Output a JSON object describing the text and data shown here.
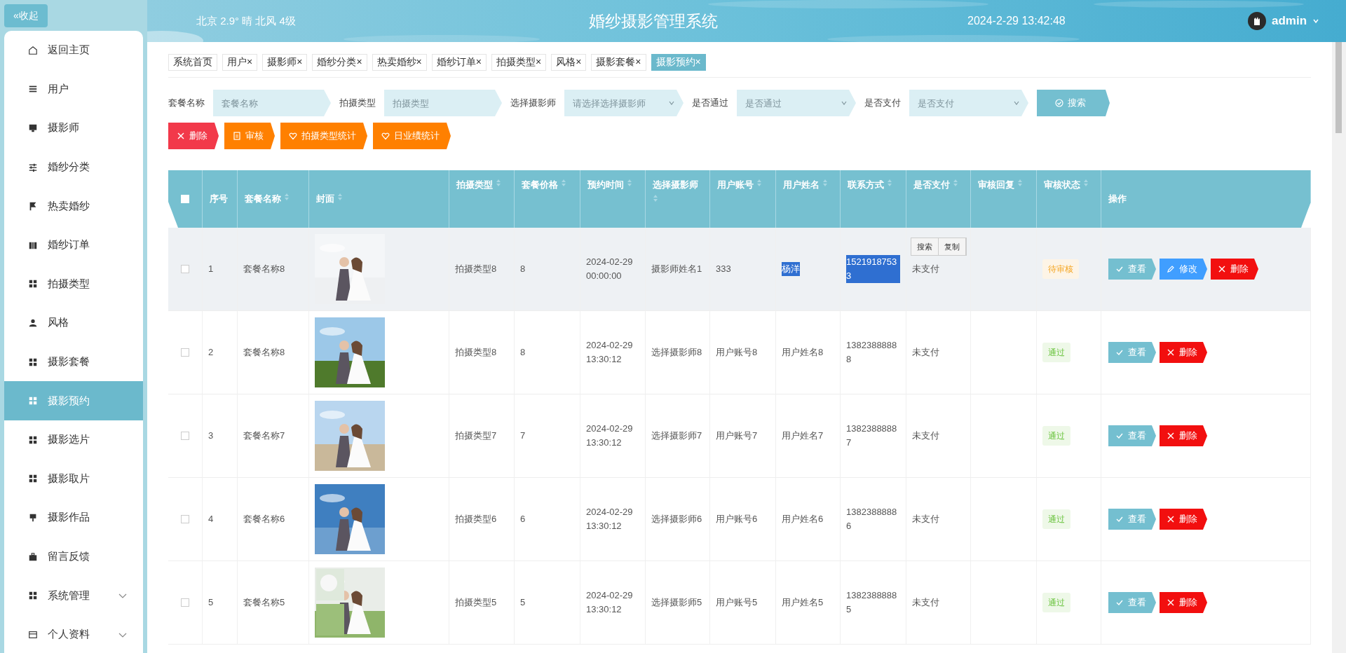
{
  "collapse_button": {
    "icon": "«",
    "label": "收起"
  },
  "header": {
    "weather": "北京 2.9° 晴 北风 4级",
    "title": "婚纱摄影管理系统",
    "datetime": "2024-2-29 13:42:48",
    "user": "admin"
  },
  "sidebar": {
    "items": [
      {
        "label": "返回主页",
        "selected": false,
        "submenu": false
      },
      {
        "label": "用户",
        "selected": false,
        "submenu": false
      },
      {
        "label": "摄影师",
        "selected": false,
        "submenu": false
      },
      {
        "label": "婚纱分类",
        "selected": false,
        "submenu": false
      },
      {
        "label": "热卖婚纱",
        "selected": false,
        "submenu": false
      },
      {
        "label": "婚纱订单",
        "selected": false,
        "submenu": false
      },
      {
        "label": "拍摄类型",
        "selected": false,
        "submenu": false
      },
      {
        "label": "风格",
        "selected": false,
        "submenu": false
      },
      {
        "label": "摄影套餐",
        "selected": false,
        "submenu": false
      },
      {
        "label": "摄影预约",
        "selected": true,
        "submenu": false
      },
      {
        "label": "摄影选片",
        "selected": false,
        "submenu": false
      },
      {
        "label": "摄影取片",
        "selected": false,
        "submenu": false
      },
      {
        "label": "摄影作品",
        "selected": false,
        "submenu": false
      },
      {
        "label": "留言反馈",
        "selected": false,
        "submenu": false
      },
      {
        "label": "系统管理",
        "selected": false,
        "submenu": true
      },
      {
        "label": "个人资料",
        "selected": false,
        "submenu": true
      }
    ]
  },
  "tabs": [
    {
      "label": "系统首页",
      "selected": false
    },
    {
      "label": "用户",
      "close": "×",
      "selected": false
    },
    {
      "label": "摄影师",
      "close": "×",
      "selected": false
    },
    {
      "label": "婚纱分类",
      "close": "×",
      "selected": false
    },
    {
      "label": "热卖婚纱",
      "close": "×",
      "selected": false
    },
    {
      "label": "婚纱订单",
      "close": "×",
      "selected": false
    },
    {
      "label": "拍摄类型",
      "close": "×",
      "selected": false
    },
    {
      "label": "风格",
      "close": "×",
      "selected": false
    },
    {
      "label": "摄影套餐",
      "close": "×",
      "selected": false
    },
    {
      "label": "摄影预约",
      "close": "×",
      "selected": true
    }
  ],
  "filters": [
    {
      "label": "套餐名称",
      "placeholder": "套餐名称",
      "kind": "text"
    },
    {
      "label": "拍摄类型",
      "placeholder": "拍摄类型",
      "kind": "text"
    },
    {
      "label": "选择摄影师",
      "placeholder": "请选择选择摄影师",
      "kind": "select"
    },
    {
      "label": "是否通过",
      "placeholder": "是否通过",
      "kind": "select"
    },
    {
      "label": "是否支付",
      "placeholder": "是否支付",
      "kind": "select"
    }
  ],
  "search_button": "搜索",
  "toolbar": [
    {
      "label": "删除",
      "kind": "delete"
    },
    {
      "label": "审核",
      "kind": "audit"
    },
    {
      "label": "拍摄类型统计",
      "kind": "stats"
    },
    {
      "label": "日业绩统计",
      "kind": "stats"
    }
  ],
  "table": {
    "select_all": {
      "checked": false
    },
    "columns": [
      {
        "label": "序号",
        "sortable": false
      },
      {
        "label": "套餐名称",
        "sortable": true
      },
      {
        "label": "封面",
        "sortable": true
      },
      {
        "label": "拍摄类型",
        "sortable": true
      },
      {
        "label": "套餐价格",
        "sortable": true
      },
      {
        "label": "预约时间",
        "sortable": true
      },
      {
        "label": "选择摄影师",
        "sortable": true
      },
      {
        "label": "用户账号",
        "sortable": true
      },
      {
        "label": "用户姓名",
        "sortable": true
      },
      {
        "label": "联系方式",
        "sortable": true
      },
      {
        "label": "是否支付",
        "sortable": true
      },
      {
        "label": "审核回复",
        "sortable": true
      },
      {
        "label": "审核状态",
        "sortable": true
      },
      {
        "label": "操作",
        "sortable": false
      }
    ],
    "rows": [
      {
        "checked": false,
        "hovered": true,
        "cells": [
          {
            "kind": "text",
            "text": "1",
            "highlighted": false
          },
          {
            "kind": "text",
            "text": "套餐名称8",
            "highlighted": false
          },
          {
            "kind": "picture"
          },
          {
            "kind": "text",
            "text": "拍摄类型8",
            "highlighted": false
          },
          {
            "kind": "text",
            "text": "8",
            "highlighted": false
          },
          {
            "kind": "text",
            "text": "2024-02-29 00:00:00",
            "highlighted": false
          },
          {
            "kind": "text",
            "text": "摄影师姓名1",
            "highlighted": false
          },
          {
            "kind": "text",
            "text": "333",
            "highlighted": false
          },
          {
            "kind": "text",
            "text": "杨洋",
            "highlighted": true
          },
          {
            "kind": "text",
            "text": "15219187533",
            "highlighted": true
          },
          {
            "kind": "text",
            "text": "未支付",
            "highlighted": false,
            "context_menu": [
              "搜索",
              "复制"
            ]
          },
          {
            "kind": "empty"
          },
          {
            "kind": "status",
            "text": "待审核",
            "approved": false
          },
          {
            "kind": "actions",
            "actions": [
              {
                "label": "查看",
                "kind": "view"
              },
              {
                "label": "修改",
                "kind": "edit"
              },
              {
                "label": "删除",
                "kind": "delete"
              }
            ]
          }
        ]
      },
      {
        "checked": false,
        "hovered": false,
        "cells": [
          {
            "kind": "text",
            "text": "2",
            "highlighted": false
          },
          {
            "kind": "text",
            "text": "套餐名称8",
            "highlighted": false
          },
          {
            "kind": "picture"
          },
          {
            "kind": "text",
            "text": "拍摄类型8",
            "highlighted": false
          },
          {
            "kind": "text",
            "text": "8",
            "highlighted": false
          },
          {
            "kind": "text",
            "text": "2024-02-29 13:30:12",
            "highlighted": false
          },
          {
            "kind": "text",
            "text": "选择摄影师8",
            "highlighted": false
          },
          {
            "kind": "text",
            "text": "用户账号8",
            "highlighted": false
          },
          {
            "kind": "text",
            "text": "用户姓名8",
            "highlighted": false
          },
          {
            "kind": "text",
            "text": "13823888888",
            "highlighted": false
          },
          {
            "kind": "text",
            "text": "未支付",
            "highlighted": false
          },
          {
            "kind": "empty"
          },
          {
            "kind": "status",
            "text": "通过",
            "approved": true
          },
          {
            "kind": "actions",
            "actions": [
              {
                "label": "查看",
                "kind": "view"
              },
              {
                "label": "删除",
                "kind": "delete"
              }
            ]
          }
        ]
      },
      {
        "checked": false,
        "hovered": false,
        "cells": [
          {
            "kind": "text",
            "text": "3",
            "highlighted": false
          },
          {
            "kind": "text",
            "text": "套餐名称7",
            "highlighted": false
          },
          {
            "kind": "picture"
          },
          {
            "kind": "text",
            "text": "拍摄类型7",
            "highlighted": false
          },
          {
            "kind": "text",
            "text": "7",
            "highlighted": false
          },
          {
            "kind": "text",
            "text": "2024-02-29 13:30:12",
            "highlighted": false
          },
          {
            "kind": "text",
            "text": "选择摄影师7",
            "highlighted": false
          },
          {
            "kind": "text",
            "text": "用户账号7",
            "highlighted": false
          },
          {
            "kind": "text",
            "text": "用户姓名7",
            "highlighted": false
          },
          {
            "kind": "text",
            "text": "13823888887",
            "highlighted": false
          },
          {
            "kind": "text",
            "text": "未支付",
            "highlighted": false
          },
          {
            "kind": "empty"
          },
          {
            "kind": "status",
            "text": "通过",
            "approved": true
          },
          {
            "kind": "actions",
            "actions": [
              {
                "label": "查看",
                "kind": "view"
              },
              {
                "label": "删除",
                "kind": "delete"
              }
            ]
          }
        ]
      },
      {
        "checked": false,
        "hovered": false,
        "cells": [
          {
            "kind": "text",
            "text": "4",
            "highlighted": false
          },
          {
            "kind": "text",
            "text": "套餐名称6",
            "highlighted": false
          },
          {
            "kind": "picture"
          },
          {
            "kind": "text",
            "text": "拍摄类型6",
            "highlighted": false
          },
          {
            "kind": "text",
            "text": "6",
            "highlighted": false
          },
          {
            "kind": "text",
            "text": "2024-02-29 13:30:12",
            "highlighted": false
          },
          {
            "kind": "text",
            "text": "选择摄影师6",
            "highlighted": false
          },
          {
            "kind": "text",
            "text": "用户账号6",
            "highlighted": false
          },
          {
            "kind": "text",
            "text": "用户姓名6",
            "highlighted": false
          },
          {
            "kind": "text",
            "text": "13823888886",
            "highlighted": false
          },
          {
            "kind": "text",
            "text": "未支付",
            "highlighted": false
          },
          {
            "kind": "empty"
          },
          {
            "kind": "status",
            "text": "通过",
            "approved": true
          },
          {
            "kind": "actions",
            "actions": [
              {
                "label": "查看",
                "kind": "view"
              },
              {
                "label": "删除",
                "kind": "delete"
              }
            ]
          }
        ]
      },
      {
        "checked": false,
        "hovered": false,
        "cells": [
          {
            "kind": "text",
            "text": "5",
            "highlighted": false
          },
          {
            "kind": "text",
            "text": "套餐名称5",
            "highlighted": false
          },
          {
            "kind": "picture"
          },
          {
            "kind": "text",
            "text": "拍摄类型5",
            "highlighted": false
          },
          {
            "kind": "text",
            "text": "5",
            "highlighted": false
          },
          {
            "kind": "text",
            "text": "2024-02-29 13:30:12",
            "highlighted": false
          },
          {
            "kind": "text",
            "text": "选择摄影师5",
            "highlighted": false
          },
          {
            "kind": "text",
            "text": "用户账号5",
            "highlighted": false
          },
          {
            "kind": "text",
            "text": "用户姓名5",
            "highlighted": false
          },
          {
            "kind": "text",
            "text": "13823888885",
            "highlighted": false
          },
          {
            "kind": "text",
            "text": "未支付",
            "highlighted": false
          },
          {
            "kind": "empty"
          },
          {
            "kind": "status",
            "text": "通过",
            "approved": true
          },
          {
            "kind": "actions",
            "actions": [
              {
                "label": "查看",
                "kind": "view"
              },
              {
                "label": "删除",
                "kind": "delete"
              }
            ]
          }
        ]
      }
    ]
  }
}
